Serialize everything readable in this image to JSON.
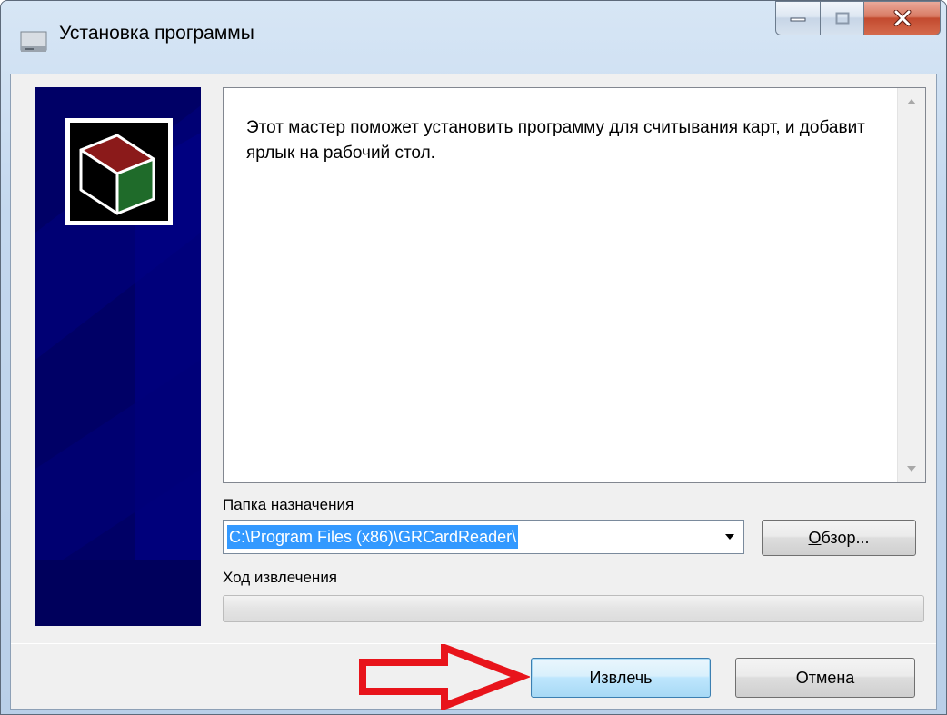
{
  "window": {
    "title": "Установка программы",
    "controls": {
      "minimize": "minimize",
      "maximize": "maximize",
      "close": "close"
    }
  },
  "body": {
    "description": "Этот мастер поможет установить программу для считывания карт, и добавит ярлык на рабочий стол."
  },
  "destination": {
    "label_accel": "П",
    "label_rest": "апка назначения",
    "value": "C:\\Program Files (x86)\\GRCardReader\\",
    "browse_accel": "О",
    "browse_rest": "бзор..."
  },
  "progress": {
    "label": "Ход извлечения",
    "value": 0
  },
  "footer": {
    "extract_label": "Извлечь",
    "cancel_label": "Отмена"
  },
  "colors": {
    "sidebar": "#000066",
    "selection": "#3399ff",
    "annotation_arrow": "#e8141b"
  },
  "icons": {
    "app": "installer-icon",
    "logo": "package-box-icon",
    "annotation": "red-arrow-icon"
  }
}
